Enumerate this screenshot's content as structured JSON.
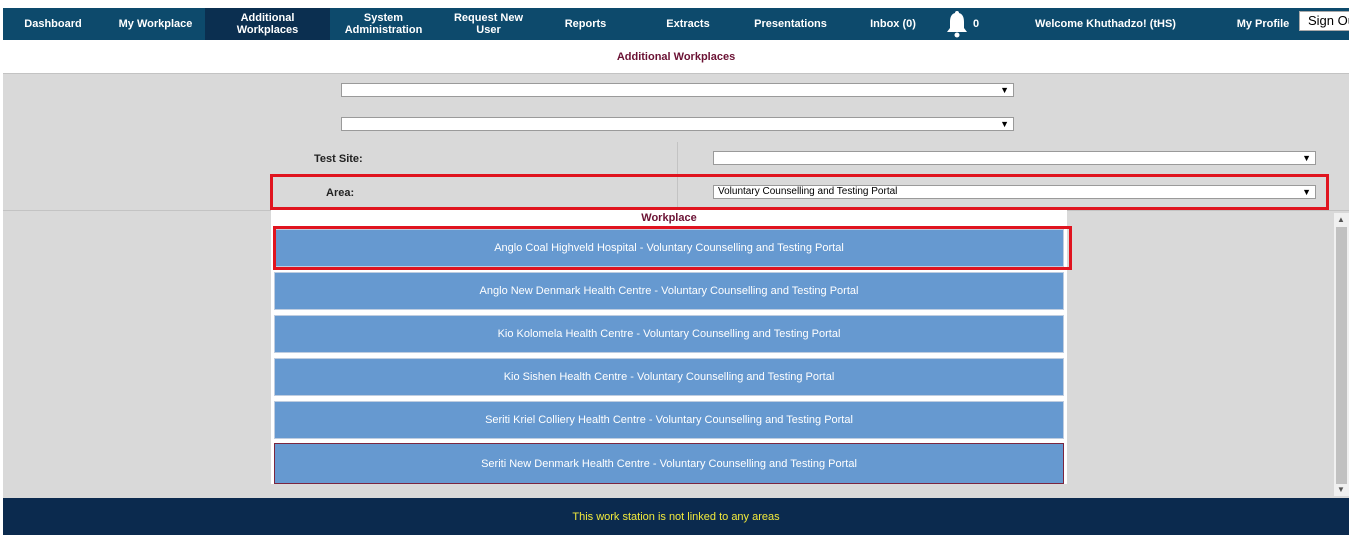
{
  "nav": {
    "items": [
      {
        "label": "Dashboard"
      },
      {
        "label": "My Workplace"
      },
      {
        "label": "Additional Workplaces"
      },
      {
        "label": "System Administration"
      },
      {
        "label": "Request New User"
      },
      {
        "label": "Reports"
      },
      {
        "label": "Extracts"
      },
      {
        "label": "Presentations"
      },
      {
        "label": "Inbox (0)"
      }
    ],
    "notification_count": "0",
    "welcome": "Welcome Khuthadzo! (tHS)",
    "my_profile": "My Profile",
    "sign_out": "Sign Out",
    "icons": {
      "notifications": "bell-icon"
    }
  },
  "page": {
    "title": "Additional Workplaces",
    "dropdown1_value": "",
    "dropdown2_value": "",
    "test_site_label": "Test Site:",
    "test_site_value": "",
    "area_label": "Area:",
    "area_value": "Voluntary Counselling and Testing Portal"
  },
  "workplace": {
    "header": "Workplace",
    "items": [
      "Anglo Coal Highveld Hospital - Voluntary Counselling and Testing Portal",
      "Anglo New Denmark Health Centre - Voluntary Counselling and Testing Portal",
      "Kio Kolomela Health Centre - Voluntary Counselling and Testing Portal",
      "Kio Sishen Health Centre - Voluntary Counselling and Testing Portal",
      "Seriti Kriel Colliery Health Centre - Voluntary Counselling and Testing Portal",
      "Seriti New Denmark Health Centre - Voluntary Counselling and Testing Portal"
    ]
  },
  "footer": {
    "message": "This work station is not linked to any areas"
  },
  "colors": {
    "nav_bg": "#0d4a6c",
    "nav_active": "#0b2f50",
    "workplace_button": "#6699d0",
    "highlight": "#e0141f",
    "footer_bg": "#0b2a4e",
    "footer_text": "#f2ea3c",
    "title_text": "#6b1234"
  }
}
